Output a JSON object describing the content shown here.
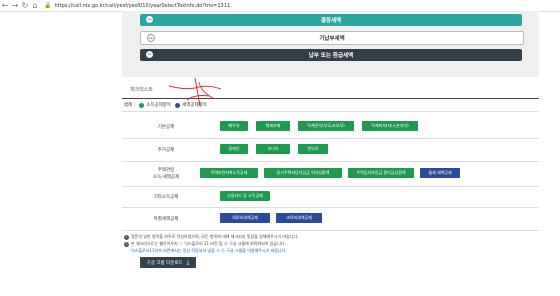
{
  "browser": {
    "back": "←",
    "forward": "→",
    "reload": "↻",
    "home": "⌂",
    "lock": "🔒",
    "url": "https://call.nts.go.kr/call/yesf/yesf010/yearSelectTaxInfo.do?tno=1311"
  },
  "accordion": [
    {
      "label": "결정세액",
      "icon": "−"
    },
    {
      "label": "기납부세액",
      "icon": "−"
    },
    {
      "label": "납부 또는 환급세액",
      "icon": "−"
    }
  ],
  "checklist": {
    "title": "체크리스트",
    "legend_label": "범례 :",
    "legend_items": [
      {
        "label": "소득공제항목",
        "color": "#1e9a50"
      },
      {
        "label": "세액공제항목",
        "color": "#2c4a9a"
      }
    ],
    "rows": [
      {
        "label": "기본공제",
        "buttons": [
          {
            "label": "배우자",
            "kind": "deduction"
          },
          {
            "label": "형제자매",
            "kind": "deduction"
          },
          {
            "label": "직계존속(부모,조부모)",
            "kind": "deduction"
          },
          {
            "label": "직계비속(자녀,손자녀)",
            "kind": "deduction"
          }
        ]
      },
      {
        "label": "추가공제",
        "buttons": [
          {
            "label": "장애인",
            "kind": "deduction"
          },
          {
            "label": "부녀자",
            "kind": "deduction"
          },
          {
            "label": "한부모",
            "kind": "deduction"
          }
        ]
      },
      {
        "label_lines": [
          "주택관련",
          "소득·세액공제"
        ],
        "buttons": [
          {
            "label": "주택마련저축소득공제",
            "kind": "deduction"
          },
          {
            "label": "장기주택저당차입금 이자상환액",
            "kind": "deduction"
          },
          {
            "label": "주택임차차입금 원리금상환액",
            "kind": "deduction"
          },
          {
            "label": "월세 세액공제",
            "kind": "credit"
          }
        ]
      },
      {
        "label": "기타소득공제",
        "buttons": [
          {
            "label": "신용카드 등 소득공제",
            "kind": "deduction"
          }
        ]
      },
      {
        "label": "특별세액공제",
        "buttons": [
          {
            "label": "의료비세액공제",
            "kind": "credit"
          },
          {
            "label": "교육비세액공제",
            "kind": "credit"
          }
        ]
      }
    ]
  },
  "notes": [
    {
      "icon": "!",
      "text": "절문의 일반 항목을 위주로 작성하였으며, 모든 항목에 대해 체크되지 못함을 양해해주시기 바랍니다."
    },
    {
      "icon": "!",
      "text": "본 체크리스트는 웹아이우저 ⓘ 익스플로러 11 버전 및 ⓖ 구글 크롬에 최적화되어 있습니다."
    },
    {
      "icon": "",
      "text": "익스플로러11이하 버전에서는 정상 작동되지 않을 시 ⓖ 구글 크롬을 이용해주시기 바랍니다."
    }
  ],
  "download_button": {
    "label": "구글 크롬 다운로드",
    "icon": "download-icon"
  },
  "colors": {
    "teal": "#2aa8a0",
    "dark": "#333f48",
    "green": "#1e9a50",
    "blue": "#2c4a9a",
    "red_mark": "#e03030"
  }
}
